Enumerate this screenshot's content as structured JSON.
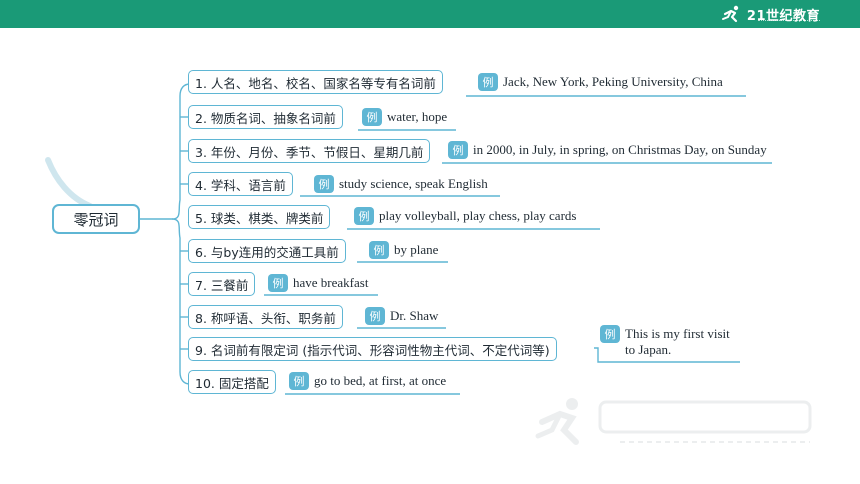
{
  "brand": {
    "logo_text": "21世纪教育"
  },
  "colors": {
    "header_green": "#1a9a77",
    "line_blue": "#5fb6d4",
    "tag_bg": "#5fb6d4",
    "text": "#1f2a33"
  },
  "mindmap": {
    "root": "零冠词",
    "example_tag": "例",
    "items": [
      {
        "label": "1. 人名、地名、校名、国家名等专有名词前",
        "example": "Jack, New York, Peking University, China"
      },
      {
        "label": "2. 物质名词、抽象名词前",
        "example": "water, hope"
      },
      {
        "label": "3. 年份、月份、季节、节假日、星期几前",
        "example": "in 2000, in July, in spring, on Christmas Day,  on Sunday"
      },
      {
        "label": "4. 学科、语言前",
        "example": "study science, speak English"
      },
      {
        "label": "5. 球类、棋类、牌类前",
        "example": "play volleyball, play chess,  play cards"
      },
      {
        "label": "6. 与by连用的交通工具前",
        "example": "by plane"
      },
      {
        "label": "7. 三餐前",
        "example": "have breakfast"
      },
      {
        "label": "8. 称呼语、头衔、职务前",
        "example": "Dr. Shaw"
      },
      {
        "label": "9. 名词前有限定词 (指示代词、形容词性物主代词、不定代词等)",
        "example_line1": "This is my first visit",
        "example_line2": "to Japan."
      },
      {
        "label": "10. 固定搭配",
        "example": "go to bed, at first, at once"
      }
    ]
  }
}
